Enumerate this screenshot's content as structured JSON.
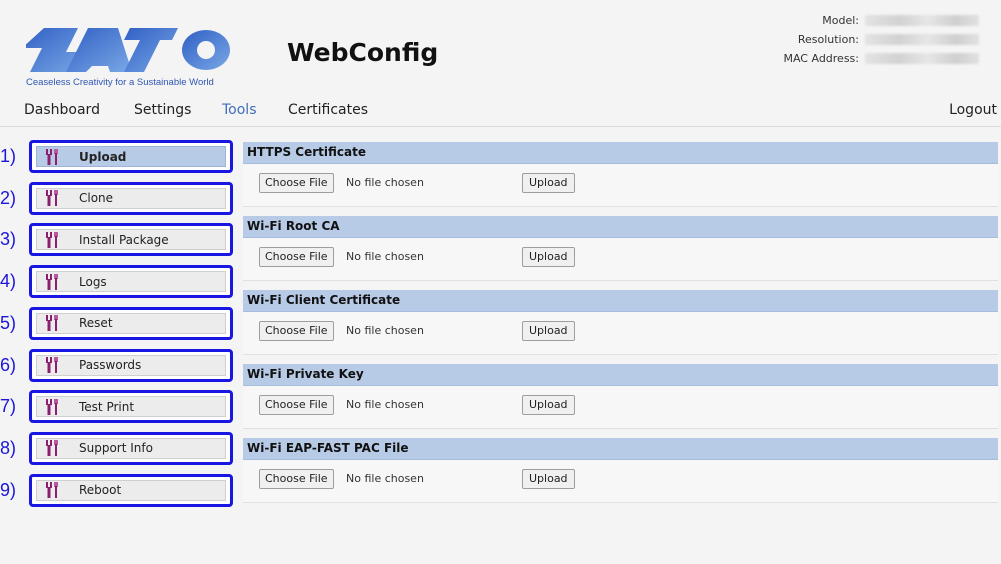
{
  "brand": {
    "tagline": "Ceaseless Creativity for a Sustainable World",
    "logo_colors": [
      "#2f5fc4",
      "#7aa8e6"
    ]
  },
  "header": {
    "title": "WebConfig",
    "info": [
      {
        "label": "Model:"
      },
      {
        "label": "Resolution:"
      },
      {
        "label": "MAC Address:"
      }
    ]
  },
  "nav": {
    "items": [
      {
        "label": "Dashboard",
        "active": false
      },
      {
        "label": "Settings",
        "active": false
      },
      {
        "label": "Tools",
        "active": true
      },
      {
        "label": "Certificates",
        "active": false
      }
    ],
    "logout": "Logout",
    "active_color": "#3f6fba"
  },
  "sidebar": {
    "icon": "tools-icon",
    "highlight_color": "#1816e0",
    "items": [
      {
        "num": "1)",
        "label": "Upload",
        "active": true
      },
      {
        "num": "2)",
        "label": "Clone",
        "active": false
      },
      {
        "num": "3)",
        "label": "Install Package",
        "active": false
      },
      {
        "num": "4)",
        "label": "Logs",
        "active": false
      },
      {
        "num": "5)",
        "label": "Reset",
        "active": false
      },
      {
        "num": "6)",
        "label": "Passwords",
        "active": false
      },
      {
        "num": "7)",
        "label": "Test Print",
        "active": false
      },
      {
        "num": "8)",
        "label": "Support Info",
        "active": false
      },
      {
        "num": "9)",
        "label": "Reboot",
        "active": false
      }
    ]
  },
  "uploads": {
    "choose_label": "Choose File",
    "no_file": "No file chosen",
    "upload_label": "Upload",
    "sections": [
      {
        "title": "HTTPS Certificate"
      },
      {
        "title": "Wi-Fi Root CA"
      },
      {
        "title": "Wi-Fi Client Certificate"
      },
      {
        "title": "Wi-Fi Private Key"
      },
      {
        "title": "Wi-Fi EAP-FAST PAC File"
      }
    ]
  }
}
